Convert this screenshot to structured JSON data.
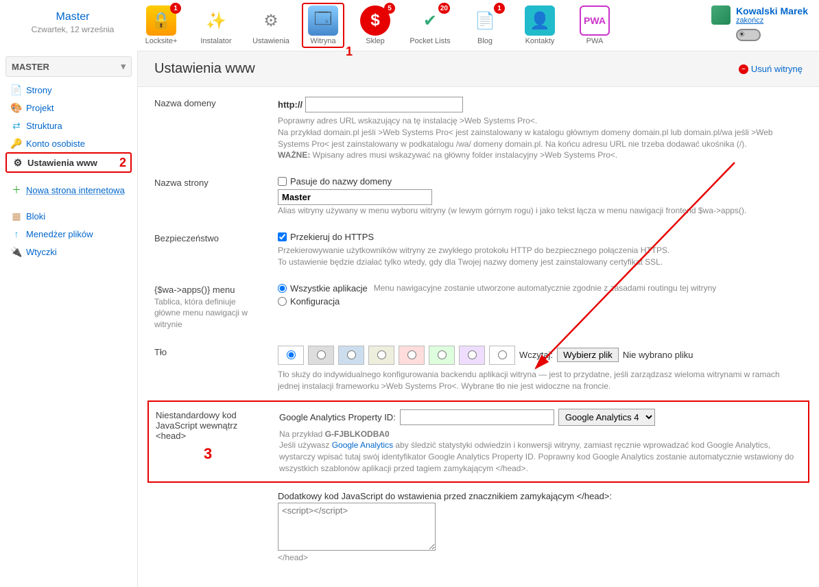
{
  "brand": {
    "title": "Master",
    "date": "Czwartek, 12 września"
  },
  "apps": [
    {
      "label": "Locksite+",
      "badge": "1"
    },
    {
      "label": "Instalator"
    },
    {
      "label": "Ustawienia"
    },
    {
      "label": "Witryna",
      "active": true,
      "annotation": "1"
    },
    {
      "label": "Sklep",
      "badge": "5"
    },
    {
      "label": "Pocket Lists",
      "badge": "20"
    },
    {
      "label": "Blog",
      "badge": "1"
    },
    {
      "label": "Kontakty"
    },
    {
      "label": "PWA"
    }
  ],
  "user": {
    "name": "Kowalski Marek",
    "logout": "zakończ"
  },
  "sidebar": {
    "header": "MASTER",
    "items": [
      {
        "label": "Strony"
      },
      {
        "label": "Projekt"
      },
      {
        "label": "Struktura"
      },
      {
        "label": "Konto osobiste"
      },
      {
        "label": "Ustawienia www",
        "selected": true,
        "annotation": "2"
      }
    ],
    "newSite": "Nowa strona internetowa",
    "blocks": "Bloki",
    "fileManager": "Menedżer plików",
    "plugins": "Wtyczki"
  },
  "page": {
    "title": "Ustawienia www",
    "deleteLabel": "Usuń witrynę"
  },
  "fields": {
    "domain": {
      "label": "Nazwa domeny",
      "prefix": "http://",
      "value": "",
      "hint1": "Poprawny adres URL wskazujący na tę instalację >Web Systems Pro<.",
      "hint2": "Na przykład domain.pl jeśli >Web Systems Pro< jest zainstalowany w katalogu głównym domeny domain.pl lub domain.pl/wa jeśli >Web Systems Pro< jest zainstalowany w podkatalogu /wa/ domeny domain.pl. Na końcu adresu URL nie trzeba dodawać ukośnika (/).",
      "hint3label": "WAŻNE:",
      "hint3": " Wpisany adres musi wskazywać na główny folder instalacyjny >Web Systems Pro<."
    },
    "siteName": {
      "label": "Nazwa strony",
      "matchDomain": "Pasuje do nazwy domeny",
      "value": "Master",
      "hint": "Alias witryny używany w menu wyboru witryny (w lewym górnym rogu) i jako tekst łącza w menu nawigacji frontend $wa->apps()."
    },
    "security": {
      "label": "Bezpieczeństwo",
      "httpsLabel": "Przekieruj do HTTPS",
      "hint1": "Przekierowywanie użytkowników witryny ze zwykłego protokołu HTTP do bezpiecznego połączenia HTTPS.",
      "hint2": "To ustawienie będzie działać tylko wtedy, gdy dla Twojej nazwy domeny jest zainstalowany certyfikat SSL."
    },
    "appsMenu": {
      "label": "{$wa->apps()} menu",
      "sublabel": "Tablica, która definiuje główne menu nawigacji w witrynie",
      "opt1": "Wszystkie aplikacje",
      "opt1hint": "Menu nawigacyjne zostanie utworzone automatycznie zgodnie z zasadami routingu tej witryny",
      "opt2": "Konfiguracja"
    },
    "background": {
      "label": "Tło",
      "uploadLabel": "Wczytaj:",
      "chooseFile": "Wybierz plik",
      "noFile": "Nie wybrano pliku",
      "hint": "Tło służy do indywidualnego konfigurowania backendu aplikacji witryna — jest to przydatne, jeśli zarządzasz wieloma witrynami w ramach jednej instalacji frameworku >Web Systems Pro<. Wybrane tło nie jest widoczne na froncie.",
      "colors": [
        "#ffffff",
        "#e0e0e0",
        "#cde",
        "#eed",
        "#fdd",
        "#dfd",
        "#edf",
        "#fff"
      ]
    },
    "ga": {
      "label": "Niestandardowy kod JavaScript wewnątrz <head>",
      "annotation": "3",
      "idLabel": "Google Analytics Property ID:",
      "idValue": "",
      "modeSelected": "Google Analytics 4",
      "exampleLabel": "Na przykład ",
      "exampleValue": "G-FJBLKODBA0",
      "hint1a": "Jeśli używasz ",
      "hint1link": "Google Analytics",
      "hint1b": " aby śledzić statystyki odwiedzin i konwersji witryny, zamiast ręcznie wprowadzać kod Google Analytics, wystarczy wpisać tutaj swój identyfikator Google Analytics Property ID. Poprawny kod Google Analytics zostanie automatycznie wstawiony do wszystkich szablonów aplikacji przed tagiem zamykającym </head>."
    },
    "extraJs": {
      "label": "Dodatkowy kod JavaScript do wstawienia przed znacznikiem zamykającym </head>:",
      "placeholder": "<script></script>",
      "closeTag": "</head>"
    }
  }
}
